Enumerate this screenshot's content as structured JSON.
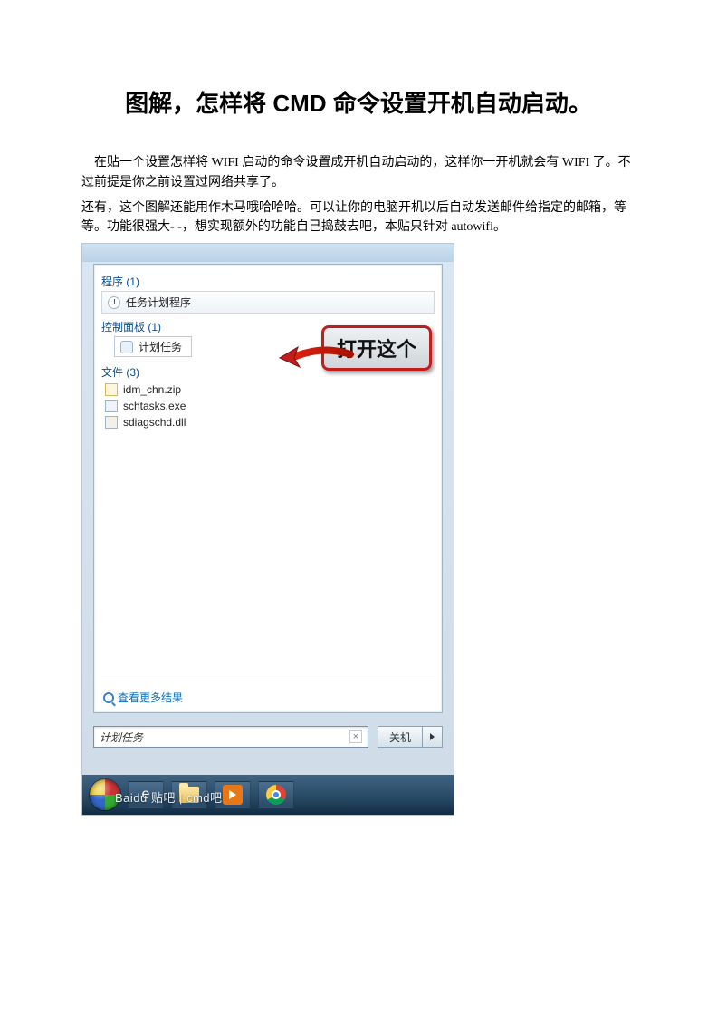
{
  "title": "图解，怎样将 CMD 命令设置开机自动启动。",
  "para1": "在贴一个设置怎样将 WIFI 启动的命令设置成开机自动启动的，这样你一开机就会有 WIFI 了。不过前提是你之前设置过网络共享了。",
  "para2": "还有，这个图解还能用作木马哦哈哈哈。可以让你的电脑开机以后自动发送邮件给指定的邮箱，等等。功能很强大- -，想实现额外的功能自己捣鼓去吧，本贴只针对 autowifi。",
  "startmenu": {
    "programs_head": "程序 (1)",
    "program_item": "任务计划程序",
    "control_head": "控制面板 (1)",
    "control_item": "计划任务",
    "files_head": "文件 (3)",
    "files": [
      {
        "name": "idm_chn.zip",
        "icon": "zip"
      },
      {
        "name": "schtasks.exe",
        "icon": "exe"
      },
      {
        "name": "sdiagschd.dll",
        "icon": "dll"
      }
    ],
    "see_more": "查看更多结果",
    "search_value": "计划任务",
    "shutdown": "关机"
  },
  "callout": "打开这个",
  "watermark": "Baidu 贴吧 | cmd吧"
}
